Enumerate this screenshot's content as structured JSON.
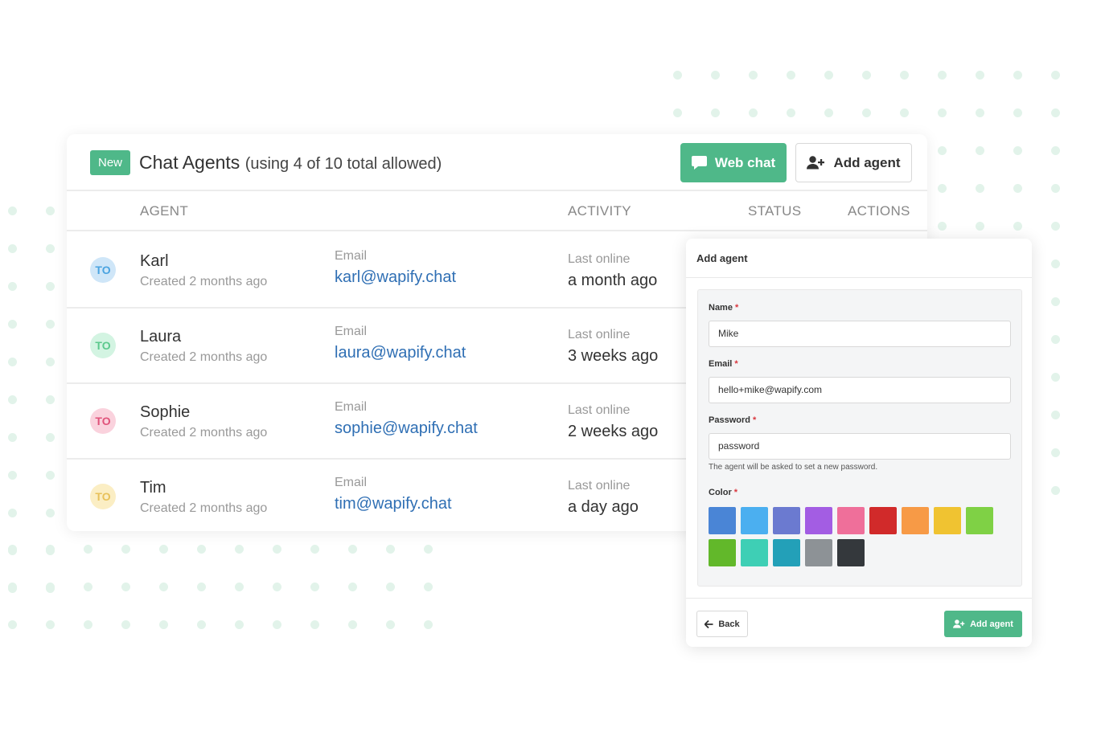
{
  "header": {
    "badge": "New",
    "title": "Chat Agents",
    "subtitle": "(using 4 of 10 total allowed)",
    "webchat_label": "Web chat",
    "add_agent_label": "Add agent"
  },
  "columns": {
    "agent": "AGENT",
    "activity": "ACTIVITY",
    "status": "STATUS",
    "actions": "ACTIONS"
  },
  "agents": [
    {
      "initials": "TO",
      "name": "Karl",
      "created": "Created 2 months ago",
      "email_label": "Email",
      "email": "karl@wapify.chat",
      "activity_label": "Last online",
      "activity": "a month ago",
      "avatar_bg": "#cfe6f8",
      "avatar_fg": "#4aa3e0"
    },
    {
      "initials": "TO",
      "name": "Laura",
      "created": "Created 2 months ago",
      "email_label": "Email",
      "email": "laura@wapify.chat",
      "activity_label": "Last online",
      "activity": "3 weeks ago",
      "avatar_bg": "#d3f4e2",
      "avatar_fg": "#5cc98d"
    },
    {
      "initials": "TO",
      "name": "Sophie",
      "created": "Created 2 months ago",
      "email_label": "Email",
      "email": "sophie@wapify.chat",
      "activity_label": "Last online",
      "activity": "2 weeks ago",
      "avatar_bg": "#fad2dd",
      "avatar_fg": "#e0527a"
    },
    {
      "initials": "TO",
      "name": "Tim",
      "created": "Created 2 months ago",
      "email_label": "Email",
      "email": "tim@wapify.chat",
      "activity_label": "Last online",
      "activity": "a day ago",
      "avatar_bg": "#fbeec4",
      "avatar_fg": "#e8c15a"
    }
  ],
  "panel": {
    "title": "Add agent",
    "name_label": "Name",
    "name_value": "Mike",
    "email_label": "Email",
    "email_value": "hello+mike@wapify.com",
    "password_label": "Password",
    "password_value": "password",
    "password_help": "The agent will be asked to set a new password.",
    "color_label": "Color",
    "required_mark": "*",
    "colors": [
      "#4a85d6",
      "#4baff0",
      "#6b7ad0",
      "#a35de3",
      "#ef6f9a",
      "#d12a2a",
      "#f79a46",
      "#f0c331",
      "#7fd145",
      "#62b82a",
      "#3ecfb5",
      "#23a0b8",
      "#8d9296",
      "#34383c"
    ],
    "back_label": "Back",
    "submit_label": "Add agent"
  },
  "colors": {
    "accent": "#4fb889",
    "link": "#2f6fb4",
    "dots": "#e2f3ea"
  }
}
